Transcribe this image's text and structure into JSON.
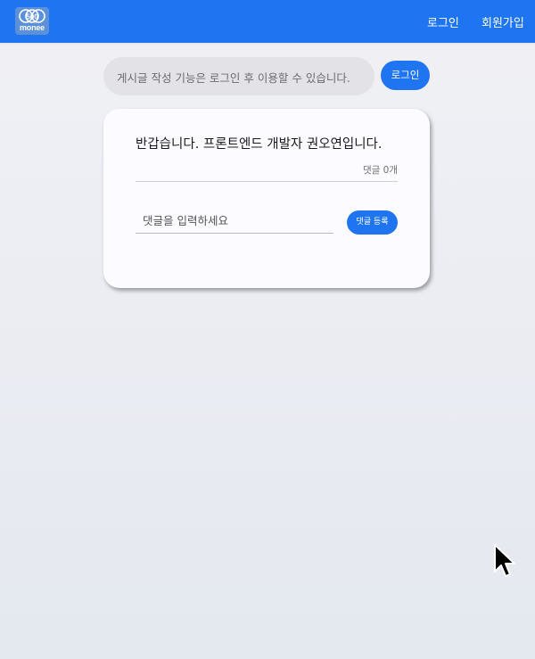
{
  "header": {
    "logo_text": "monee",
    "logo_mark": "500",
    "login_label": "로그인",
    "signup_label": "회원가입"
  },
  "notice": {
    "text": "게시글 작성 기능은 로그인 후 이용할 수 있습니다.",
    "login_button": "로그인"
  },
  "post": {
    "title": "반갑습니다. 프론트엔드 개발자 권오연입니다.",
    "comment_count": "댓글 0개",
    "comment_placeholder": "댓글을 입력하세요",
    "comment_button": "댓글 등록"
  },
  "colors": {
    "primary": "#1f74f2",
    "background": "#eceef2",
    "card": "#fcfbff"
  }
}
